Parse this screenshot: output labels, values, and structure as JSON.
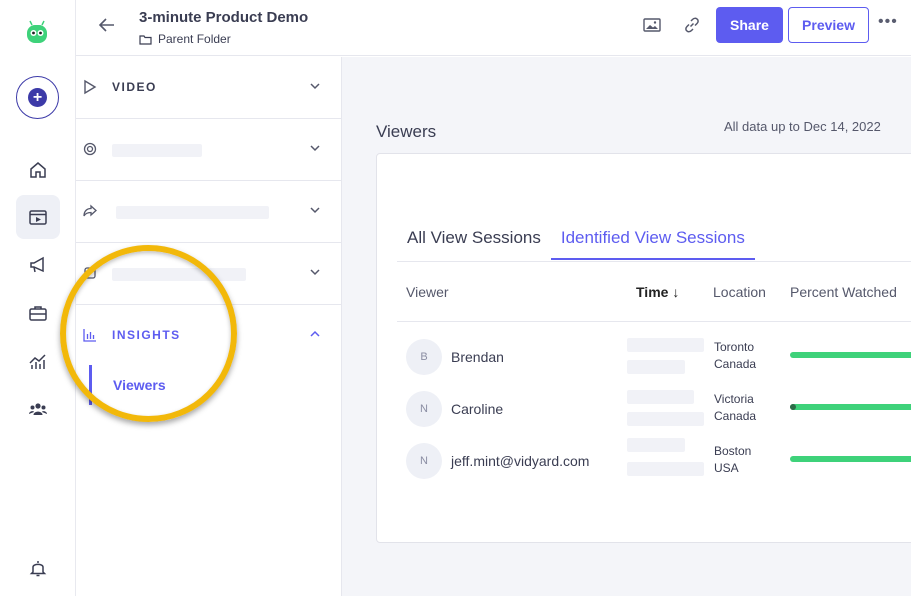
{
  "header": {
    "title": "3-minute Product Demo",
    "folder": "Parent Folder",
    "share_label": "Share",
    "preview_label": "Preview",
    "more_label": "•••"
  },
  "panel": {
    "video_label": "VIDEO",
    "insights_label": "INSIGHTS",
    "viewers_label": "Viewers"
  },
  "main": {
    "title": "Viewers",
    "data_note": "All data up to Dec 14, 2022",
    "tabs": [
      {
        "label": "All View Sessions",
        "active": false
      },
      {
        "label": "Identified View Sessions",
        "active": true
      }
    ],
    "columns": {
      "viewer": "Viewer",
      "time": "Time ↓",
      "location": "Location",
      "percent": "Percent Watched"
    },
    "rows": [
      {
        "initial": "B",
        "name": "Brendan",
        "city": "Toronto",
        "country": "Canada",
        "percent_watched": 1.0
      },
      {
        "initial": "N",
        "name": "Caroline",
        "city": "Victoria",
        "country": "Canada",
        "percent_watched": 1.0
      },
      {
        "initial": "N",
        "name": "jeff.mint@vidyard.com",
        "city": "Boston",
        "country": "USA",
        "percent_watched": 1.0
      }
    ]
  },
  "colors": {
    "accent": "#5d5cf0",
    "highlight_ring": "#f2b80a",
    "progress": "#3ed27a"
  }
}
